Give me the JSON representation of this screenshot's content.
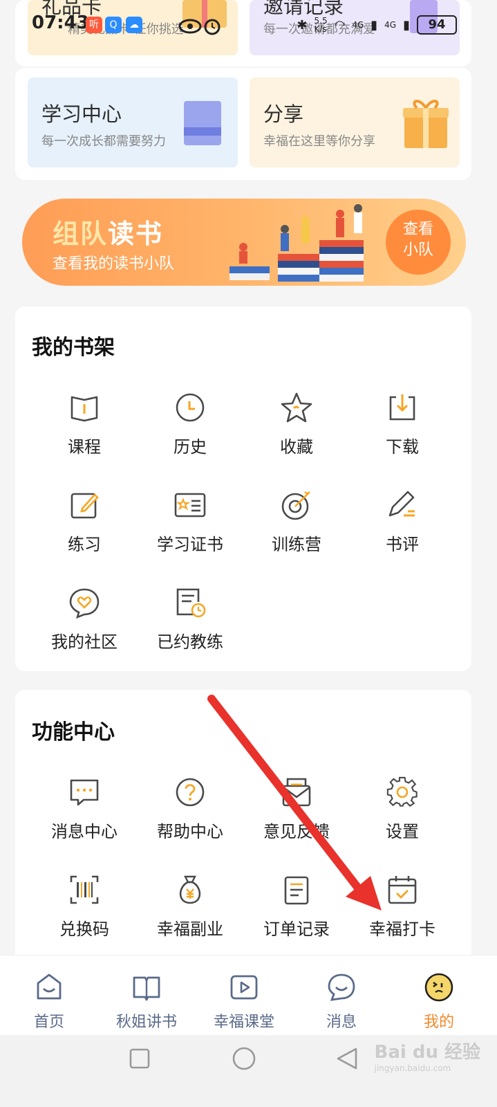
{
  "status_bar": {
    "time": "07:43",
    "app_icon_1": "听",
    "network_speed": "5.5\nK/s",
    "net1": "4G",
    "net2": "4G",
    "battery": "94"
  },
  "top_cards": [
    {
      "title": "礼品卡",
      "subtitle": "精美礼品卡 任你挑选"
    },
    {
      "title": "邀请记录",
      "subtitle": "每一次邀请都充满爱"
    },
    {
      "title": "学习中心",
      "subtitle": "每一次成长都需要努力"
    },
    {
      "title": "分享",
      "subtitle": "幸福在这里等你分享"
    }
  ],
  "banner": {
    "title_part1": "组队",
    "title_part2": "读书",
    "subtitle": "查看我的读书小队",
    "button_line1": "查看",
    "button_line2": "小队"
  },
  "bookshelf": {
    "title": "我的书架",
    "items": [
      {
        "label": "课程",
        "icon": "book-open-icon"
      },
      {
        "label": "历史",
        "icon": "clock-icon"
      },
      {
        "label": "收藏",
        "icon": "star-icon"
      },
      {
        "label": "下载",
        "icon": "download-icon"
      },
      {
        "label": "练习",
        "icon": "edit-square-icon"
      },
      {
        "label": "学习证书",
        "icon": "certificate-icon"
      },
      {
        "label": "训练营",
        "icon": "target-icon"
      },
      {
        "label": "书评",
        "icon": "pen-icon"
      },
      {
        "label": "我的社区",
        "icon": "heart-bubble-icon"
      },
      {
        "label": "已约教练",
        "icon": "document-clock-icon"
      }
    ]
  },
  "function_center": {
    "title": "功能中心",
    "items": [
      {
        "label": "消息中心",
        "icon": "chat-dots-icon"
      },
      {
        "label": "帮助中心",
        "icon": "question-icon"
      },
      {
        "label": "意见反馈",
        "icon": "envelope-icon"
      },
      {
        "label": "设置",
        "icon": "gear-icon"
      },
      {
        "label": "兑换码",
        "icon": "barcode-icon"
      },
      {
        "label": "幸福副业",
        "icon": "money-bag-icon"
      },
      {
        "label": "订单记录",
        "icon": "clipboard-icon"
      },
      {
        "label": "幸福打卡",
        "icon": "calendar-check-icon"
      }
    ]
  },
  "bottom_nav": [
    {
      "label": "首页",
      "icon": "home-smile-icon"
    },
    {
      "label": "秋姐讲书",
      "icon": "book-icon"
    },
    {
      "label": "幸福课堂",
      "icon": "video-play-icon"
    },
    {
      "label": "消息",
      "icon": "message-smile-icon"
    },
    {
      "label": "我的",
      "icon": "profile-face-icon",
      "active": true
    }
  ],
  "colors": {
    "accent": "#f08a2e",
    "nav_inactive": "#5a6a8a",
    "icon_stroke": "#4a4a4a",
    "icon_accent": "#f5a623",
    "annotation_arrow": "#e8322b"
  },
  "watermark": {
    "text": "Bai du 经验",
    "url_text": "jingyan.baidu.com"
  }
}
